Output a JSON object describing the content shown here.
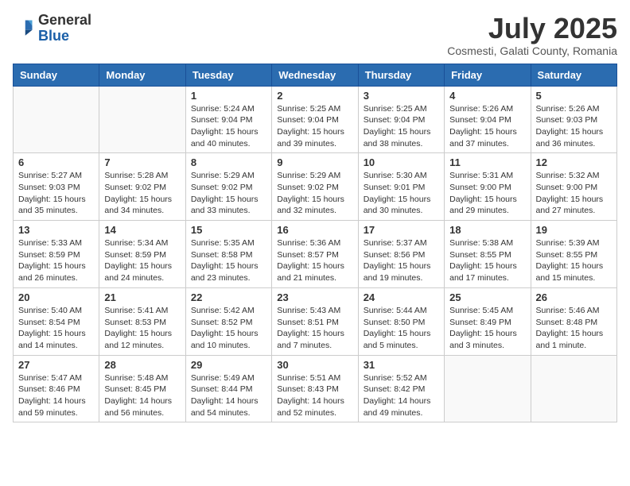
{
  "header": {
    "logo_general": "General",
    "logo_blue": "Blue",
    "month_title": "July 2025",
    "subtitle": "Cosmesti, Galati County, Romania"
  },
  "weekdays": [
    "Sunday",
    "Monday",
    "Tuesday",
    "Wednesday",
    "Thursday",
    "Friday",
    "Saturday"
  ],
  "weeks": [
    [
      {
        "day": "",
        "sunrise": "",
        "sunset": "",
        "daylight": ""
      },
      {
        "day": "",
        "sunrise": "",
        "sunset": "",
        "daylight": ""
      },
      {
        "day": "1",
        "sunrise": "Sunrise: 5:24 AM",
        "sunset": "Sunset: 9:04 PM",
        "daylight": "Daylight: 15 hours and 40 minutes."
      },
      {
        "day": "2",
        "sunrise": "Sunrise: 5:25 AM",
        "sunset": "Sunset: 9:04 PM",
        "daylight": "Daylight: 15 hours and 39 minutes."
      },
      {
        "day": "3",
        "sunrise": "Sunrise: 5:25 AM",
        "sunset": "Sunset: 9:04 PM",
        "daylight": "Daylight: 15 hours and 38 minutes."
      },
      {
        "day": "4",
        "sunrise": "Sunrise: 5:26 AM",
        "sunset": "Sunset: 9:04 PM",
        "daylight": "Daylight: 15 hours and 37 minutes."
      },
      {
        "day": "5",
        "sunrise": "Sunrise: 5:26 AM",
        "sunset": "Sunset: 9:03 PM",
        "daylight": "Daylight: 15 hours and 36 minutes."
      }
    ],
    [
      {
        "day": "6",
        "sunrise": "Sunrise: 5:27 AM",
        "sunset": "Sunset: 9:03 PM",
        "daylight": "Daylight: 15 hours and 35 minutes."
      },
      {
        "day": "7",
        "sunrise": "Sunrise: 5:28 AM",
        "sunset": "Sunset: 9:02 PM",
        "daylight": "Daylight: 15 hours and 34 minutes."
      },
      {
        "day": "8",
        "sunrise": "Sunrise: 5:29 AM",
        "sunset": "Sunset: 9:02 PM",
        "daylight": "Daylight: 15 hours and 33 minutes."
      },
      {
        "day": "9",
        "sunrise": "Sunrise: 5:29 AM",
        "sunset": "Sunset: 9:02 PM",
        "daylight": "Daylight: 15 hours and 32 minutes."
      },
      {
        "day": "10",
        "sunrise": "Sunrise: 5:30 AM",
        "sunset": "Sunset: 9:01 PM",
        "daylight": "Daylight: 15 hours and 30 minutes."
      },
      {
        "day": "11",
        "sunrise": "Sunrise: 5:31 AM",
        "sunset": "Sunset: 9:00 PM",
        "daylight": "Daylight: 15 hours and 29 minutes."
      },
      {
        "day": "12",
        "sunrise": "Sunrise: 5:32 AM",
        "sunset": "Sunset: 9:00 PM",
        "daylight": "Daylight: 15 hours and 27 minutes."
      }
    ],
    [
      {
        "day": "13",
        "sunrise": "Sunrise: 5:33 AM",
        "sunset": "Sunset: 8:59 PM",
        "daylight": "Daylight: 15 hours and 26 minutes."
      },
      {
        "day": "14",
        "sunrise": "Sunrise: 5:34 AM",
        "sunset": "Sunset: 8:59 PM",
        "daylight": "Daylight: 15 hours and 24 minutes."
      },
      {
        "day": "15",
        "sunrise": "Sunrise: 5:35 AM",
        "sunset": "Sunset: 8:58 PM",
        "daylight": "Daylight: 15 hours and 23 minutes."
      },
      {
        "day": "16",
        "sunrise": "Sunrise: 5:36 AM",
        "sunset": "Sunset: 8:57 PM",
        "daylight": "Daylight: 15 hours and 21 minutes."
      },
      {
        "day": "17",
        "sunrise": "Sunrise: 5:37 AM",
        "sunset": "Sunset: 8:56 PM",
        "daylight": "Daylight: 15 hours and 19 minutes."
      },
      {
        "day": "18",
        "sunrise": "Sunrise: 5:38 AM",
        "sunset": "Sunset: 8:55 PM",
        "daylight": "Daylight: 15 hours and 17 minutes."
      },
      {
        "day": "19",
        "sunrise": "Sunrise: 5:39 AM",
        "sunset": "Sunset: 8:55 PM",
        "daylight": "Daylight: 15 hours and 15 minutes."
      }
    ],
    [
      {
        "day": "20",
        "sunrise": "Sunrise: 5:40 AM",
        "sunset": "Sunset: 8:54 PM",
        "daylight": "Daylight: 15 hours and 14 minutes."
      },
      {
        "day": "21",
        "sunrise": "Sunrise: 5:41 AM",
        "sunset": "Sunset: 8:53 PM",
        "daylight": "Daylight: 15 hours and 12 minutes."
      },
      {
        "day": "22",
        "sunrise": "Sunrise: 5:42 AM",
        "sunset": "Sunset: 8:52 PM",
        "daylight": "Daylight: 15 hours and 10 minutes."
      },
      {
        "day": "23",
        "sunrise": "Sunrise: 5:43 AM",
        "sunset": "Sunset: 8:51 PM",
        "daylight": "Daylight: 15 hours and 7 minutes."
      },
      {
        "day": "24",
        "sunrise": "Sunrise: 5:44 AM",
        "sunset": "Sunset: 8:50 PM",
        "daylight": "Daylight: 15 hours and 5 minutes."
      },
      {
        "day": "25",
        "sunrise": "Sunrise: 5:45 AM",
        "sunset": "Sunset: 8:49 PM",
        "daylight": "Daylight: 15 hours and 3 minutes."
      },
      {
        "day": "26",
        "sunrise": "Sunrise: 5:46 AM",
        "sunset": "Sunset: 8:48 PM",
        "daylight": "Daylight: 15 hours and 1 minute."
      }
    ],
    [
      {
        "day": "27",
        "sunrise": "Sunrise: 5:47 AM",
        "sunset": "Sunset: 8:46 PM",
        "daylight": "Daylight: 14 hours and 59 minutes."
      },
      {
        "day": "28",
        "sunrise": "Sunrise: 5:48 AM",
        "sunset": "Sunset: 8:45 PM",
        "daylight": "Daylight: 14 hours and 56 minutes."
      },
      {
        "day": "29",
        "sunrise": "Sunrise: 5:49 AM",
        "sunset": "Sunset: 8:44 PM",
        "daylight": "Daylight: 14 hours and 54 minutes."
      },
      {
        "day": "30",
        "sunrise": "Sunrise: 5:51 AM",
        "sunset": "Sunset: 8:43 PM",
        "daylight": "Daylight: 14 hours and 52 minutes."
      },
      {
        "day": "31",
        "sunrise": "Sunrise: 5:52 AM",
        "sunset": "Sunset: 8:42 PM",
        "daylight": "Daylight: 14 hours and 49 minutes."
      },
      {
        "day": "",
        "sunrise": "",
        "sunset": "",
        "daylight": ""
      },
      {
        "day": "",
        "sunrise": "",
        "sunset": "",
        "daylight": ""
      }
    ]
  ]
}
